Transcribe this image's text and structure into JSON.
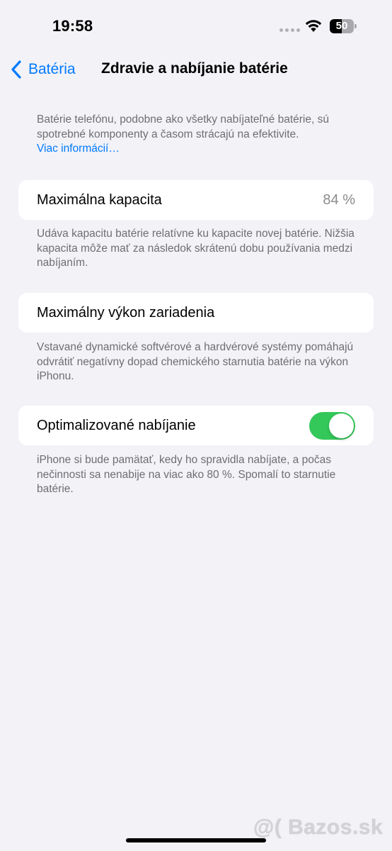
{
  "status_bar": {
    "time": "19:58",
    "battery_percent": "50",
    "battery_level": 0.5,
    "wifi_icon": "wifi-icon",
    "signal_icon": "cellular-no-service-icon"
  },
  "nav": {
    "back_label": "Batéria",
    "back_icon": "chevron-left-icon",
    "title": "Zdravie a nabíjanie batérie"
  },
  "intro": {
    "text": "Batérie telefónu, podobne ako všetky nabíjateľné batérie, sú spotrebné komponenty a časom strácajú na efektivite.",
    "link": "Viac informácií…"
  },
  "max_capacity": {
    "label": "Maximálna kapacita",
    "value": "84 %",
    "footnote": "Udáva kapacitu batérie relatívne ku kapacite novej batérie. Nižšia kapacita môže mať za následok skrátenú dobu používania medzi nabíjaním."
  },
  "peak_performance": {
    "label": "Maximálny výkon zariadenia",
    "footnote": "Vstavané dynamické softvérové a hardvérové systémy pomáhajú odvrátiť negatívny dopad chemického starnutia batérie na výkon iPhonu."
  },
  "optimized_charging": {
    "label": "Optimalizované nabíjanie",
    "enabled": true,
    "toggle_color": "#34c759",
    "footnote": "iPhone si bude pamätať, kedy ho spravidla nabíjate, a počas nečinnosti sa nenabije na viac ako 80 %. Spomalí to starnutie batérie."
  },
  "watermark": "@( Bazos.sk",
  "colors": {
    "background": "#f2f2f7",
    "accent": "#007aff",
    "secondary_text": "#6e6e73"
  }
}
